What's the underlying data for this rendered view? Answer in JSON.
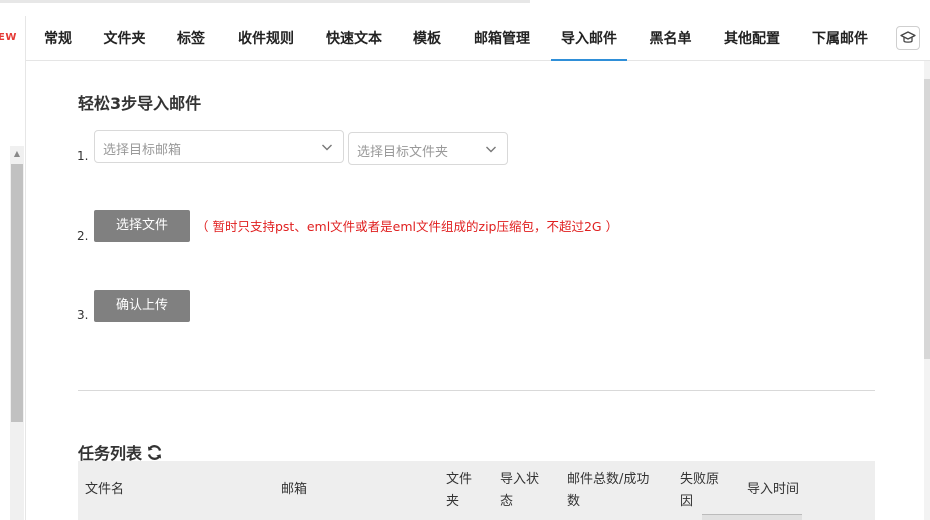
{
  "sidebar": {
    "new_label": "EW"
  },
  "tabs": [
    {
      "label": "常规",
      "active": false
    },
    {
      "label": "文件夹",
      "active": false
    },
    {
      "label": "标签",
      "active": false
    },
    {
      "label": "收件规则",
      "active": false
    },
    {
      "label": "快速文本",
      "active": false
    },
    {
      "label": "模板",
      "active": false
    },
    {
      "label": "邮箱管理",
      "active": false
    },
    {
      "label": "导入邮件",
      "active": true
    },
    {
      "label": "黑名单",
      "active": false
    },
    {
      "label": "其他配置",
      "active": false
    },
    {
      "label": "下属邮件",
      "active": false
    }
  ],
  "help_icon": "graduation-cap-icon",
  "import": {
    "title": "轻松3步导入邮件",
    "step1_num": "1.",
    "step2_num": "2.",
    "step3_num": "3.",
    "select_mailbox_placeholder": "选择目标邮箱",
    "select_folder_placeholder": "选择目标文件夹",
    "choose_file_label": "选择文件",
    "note": "（ 暂时只支持pst、eml文件或者是eml文件组成的zip压缩包，不超过2G ）",
    "confirm_upload_label": "确认上传"
  },
  "tasks": {
    "title": "任务列表",
    "refresh_icon": "refresh-icon",
    "columns": {
      "filename": "文件名",
      "mailbox": "邮箱",
      "folder_l1": "文件",
      "folder_l2": "夹",
      "status_l1": "导入状",
      "status_l2": "态",
      "count_l1": "邮件总数/成功",
      "count_l2": "数",
      "fail_l1": "失败原",
      "fail_l2": "因",
      "time": "导入时间"
    }
  }
}
